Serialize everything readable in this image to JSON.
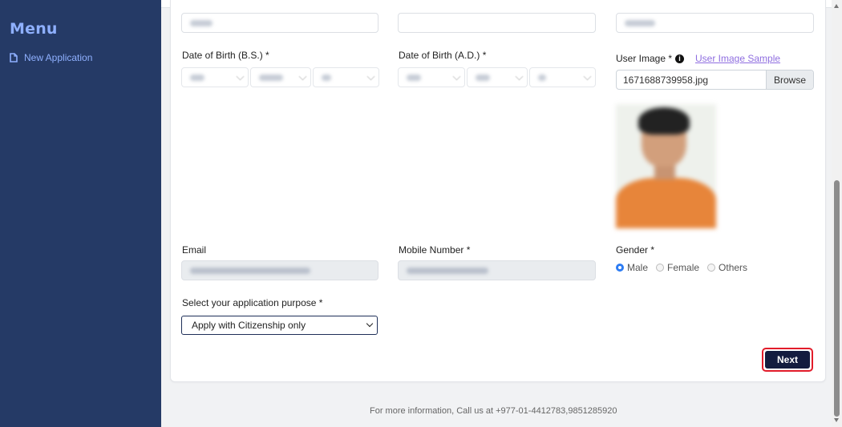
{
  "sidebar": {
    "title": "Menu",
    "items": [
      {
        "label": "New Application",
        "icon": "document-icon"
      }
    ]
  },
  "form": {
    "dob_bs_label": "Date of Birth (B.S.) *",
    "dob_ad_label": "Date of Birth (A.D.) *",
    "user_image_label": "User Image *",
    "user_image_sample_link": "User Image Sample",
    "file_name": "1671688739958.jpg",
    "browse_label": "Browse",
    "email_label": "Email",
    "mobile_label": "Mobile Number *",
    "gender_label": "Gender *",
    "gender_options": [
      "Male",
      "Female",
      "Others"
    ],
    "gender_selected": "Male",
    "purpose_label": "Select your application purpose *",
    "purpose_value": "Apply with Citizenship only",
    "next_label": "Next"
  },
  "footer": {
    "text": "For more information, Call us at +977-01-4412783,9851285920"
  },
  "colors": {
    "sidebar_bg": "#253a66",
    "sidebar_text": "#8fb0ff",
    "next_bg": "#131c3f",
    "next_border": "#e21c2a",
    "link": "#8f6ee0",
    "radio_checked": "#2d7cf3"
  }
}
